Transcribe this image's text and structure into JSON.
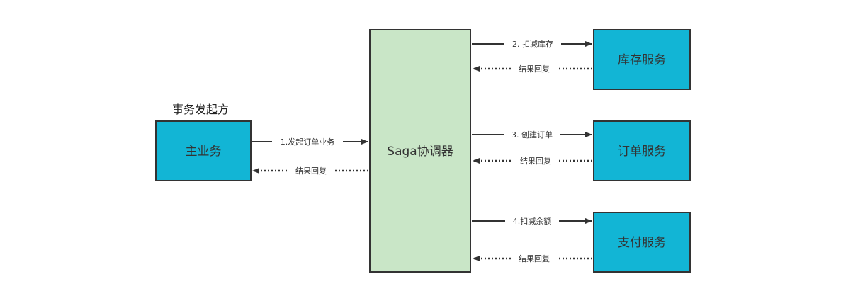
{
  "colors": {
    "service_fill": "#12b5d5",
    "coordinator_fill": "#c9e6c7",
    "border": "#333333",
    "line": "#333333"
  },
  "initiator_caption": "事务发起方",
  "nodes": {
    "main": "主业务",
    "coordinator": "Saga协调器",
    "inventory": "库存服务",
    "order": "订单服务",
    "payment": "支付服务"
  },
  "edges": {
    "start_order": "1.发起订单业务",
    "reply_main": "结果回复",
    "deduct_stock": "2. 扣减库存",
    "reply_inventory": "结果回复",
    "create_order": "3. 创建订单",
    "reply_order": "结果回复",
    "deduct_balance": "4.扣减余额",
    "reply_payment": "结果回复"
  }
}
